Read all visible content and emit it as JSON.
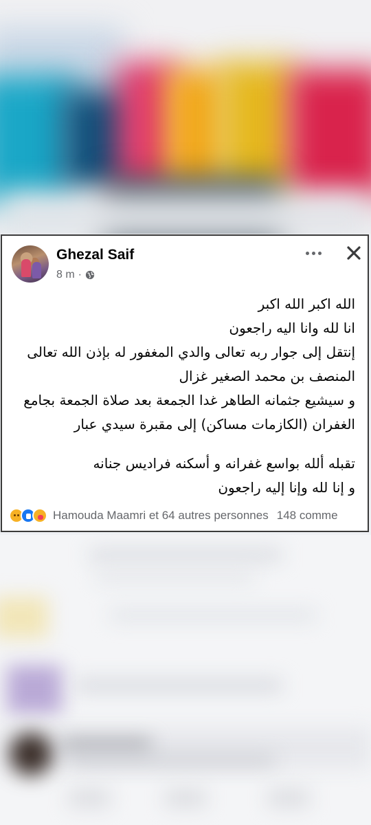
{
  "post": {
    "author": "Ghezal Saif",
    "time": "8 m",
    "separator": "·",
    "privacy_icon": "globe-icon",
    "more_icon": "more-dots-icon",
    "close_icon": "close-icon",
    "lines": [
      "الله اكبر  الله اكبر",
      "انا  لله وانا اليه راجعون",
      "إنتقل إلى جوار ربه تعالى والدي  المغفور له بإذن الله تعالى",
      "المنصف بن محمد الصغير غزال",
      "و سيشيع جثمانه الطاهر غدا الجمعة بعد صلاة الجمعة بجامع",
      "الغفران (الكازمات مساكن) إلى مقبرة سيدي عبار",
      "تقبله ألله بواسع غفرانه و أسكنه فراديس جنانه",
      "و إنا لله وإنا إليه راجعون"
    ]
  },
  "reactions": {
    "icons": [
      "sad-reaction-icon",
      "like-reaction-icon",
      "care-reaction-icon"
    ],
    "summary": "Hamouda Maamri et 64 autres personnes",
    "comments": "148 comme"
  },
  "colors": {
    "text": "#050505",
    "secondary": "#65676b",
    "card_border": "#3a3a3a",
    "like_blue": "#1877f2"
  }
}
